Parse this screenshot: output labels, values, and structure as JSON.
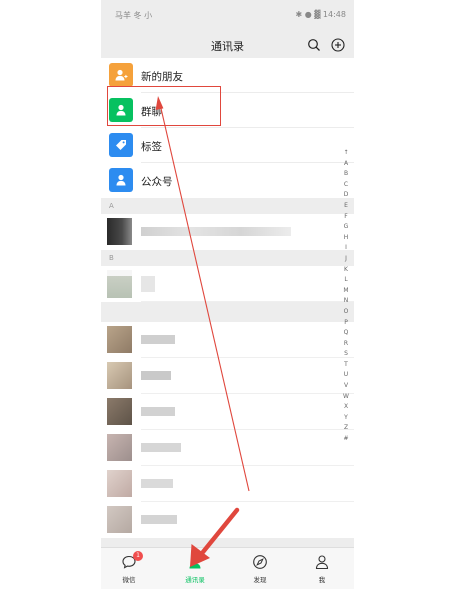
{
  "statusbar": {
    "left": "马羊 冬 小",
    "right": "✱ ● ▓ 14:48"
  },
  "header": {
    "title": "通讯录",
    "search_icon": "search-icon",
    "add_icon": "plus-circle-icon"
  },
  "shortcuts": [
    {
      "label": "新的朋友",
      "icon": "add-friend-icon",
      "color": "#f5a13b"
    },
    {
      "label": "群聊",
      "icon": "group-chat-icon",
      "color": "#07c160"
    },
    {
      "label": "标签",
      "icon": "tag-icon",
      "color": "#2d8cf0"
    },
    {
      "label": "公众号",
      "icon": "official-account-icon",
      "color": "#2d8cf0"
    }
  ],
  "sections": [
    "A",
    "B",
    ""
  ],
  "alphabet": [
    "↑",
    "A",
    "B",
    "C",
    "D",
    "E",
    "F",
    "G",
    "H",
    "I",
    "J",
    "K",
    "L",
    "M",
    "N",
    "O",
    "P",
    "Q",
    "R",
    "S",
    "T",
    "U",
    "V",
    "W",
    "X",
    "Y",
    "Z",
    "#"
  ],
  "tabs": [
    {
      "label": "微信",
      "icon": "chat-bubble-icon",
      "badge": "1"
    },
    {
      "label": "通讯录",
      "icon": "contacts-icon",
      "active": true
    },
    {
      "label": "发现",
      "icon": "compass-icon"
    },
    {
      "label": "我",
      "icon": "person-icon"
    }
  ],
  "colors": {
    "accent": "#07c160",
    "annotation": "#e0473d"
  }
}
